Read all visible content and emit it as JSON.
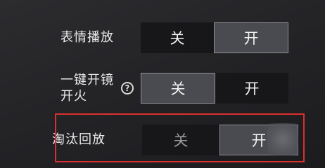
{
  "settings": [
    {
      "label_line1": "表情播放",
      "off_label": "关",
      "on_label": "开",
      "state": "on"
    },
    {
      "label_line1": "一键开镜",
      "label_line2": "开火",
      "help_icon": "question-circle-icon",
      "off_label": "关",
      "on_label": "开",
      "state": "off"
    },
    {
      "label_line1": "淘汰回放",
      "off_label": "关",
      "on_label": "开",
      "state": "on"
    }
  ],
  "colors": {
    "background": "#242427",
    "selected_segment": "#4a4b50",
    "unselected_segment": "#17171a",
    "highlight_border": "#d9302f"
  }
}
